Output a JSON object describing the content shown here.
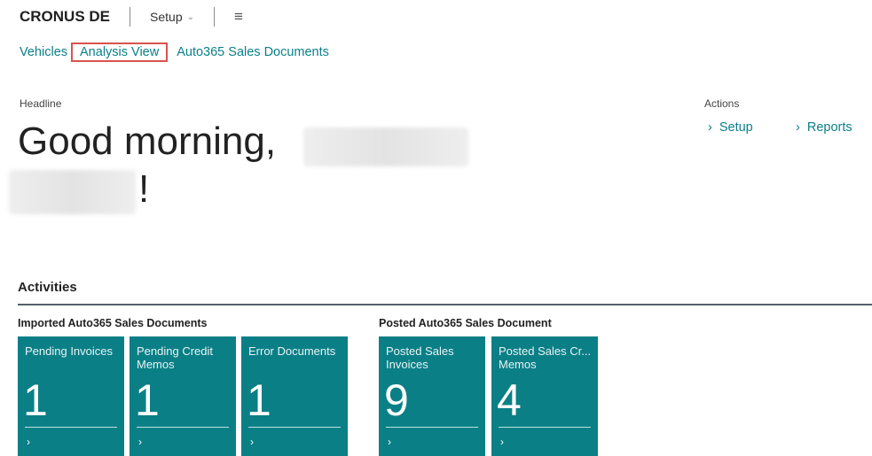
{
  "header": {
    "company": "CRONUS DE",
    "menu_label": "Setup",
    "menu_icon": "chevron-down-icon",
    "hamburger_icon": "hamburger-icon"
  },
  "nav": {
    "items": [
      {
        "label": "Vehicles"
      },
      {
        "label": "Analysis View"
      },
      {
        "label": "Auto365 Sales Documents"
      }
    ]
  },
  "headline": {
    "label": "Headline",
    "greeting": "Good morning,",
    "exclamation": "!"
  },
  "actions": {
    "label": "Actions",
    "items": [
      {
        "label": "Setup",
        "icon": "chevron-right-icon"
      },
      {
        "label": "Reports",
        "icon": "chevron-right-icon"
      }
    ]
  },
  "activities": {
    "title": "Activities",
    "groups": [
      {
        "title": "Imported Auto365 Sales Documents",
        "tiles": [
          {
            "label": "Pending Invoices",
            "value": "1"
          },
          {
            "label": "Pending Credit Memos",
            "value": "1"
          },
          {
            "label": "Error Documents",
            "value": "1"
          }
        ]
      },
      {
        "title": "Posted Auto365 Sales Document",
        "tiles": [
          {
            "label": "Posted Sales Invoices",
            "value": "9"
          },
          {
            "label": "Posted Sales Cr... Memos",
            "value": "4"
          }
        ]
      }
    ]
  },
  "colors": {
    "tile_bg": "#0b7f86",
    "link": "#0b7f8a",
    "selected_outline": "#d9534f"
  }
}
